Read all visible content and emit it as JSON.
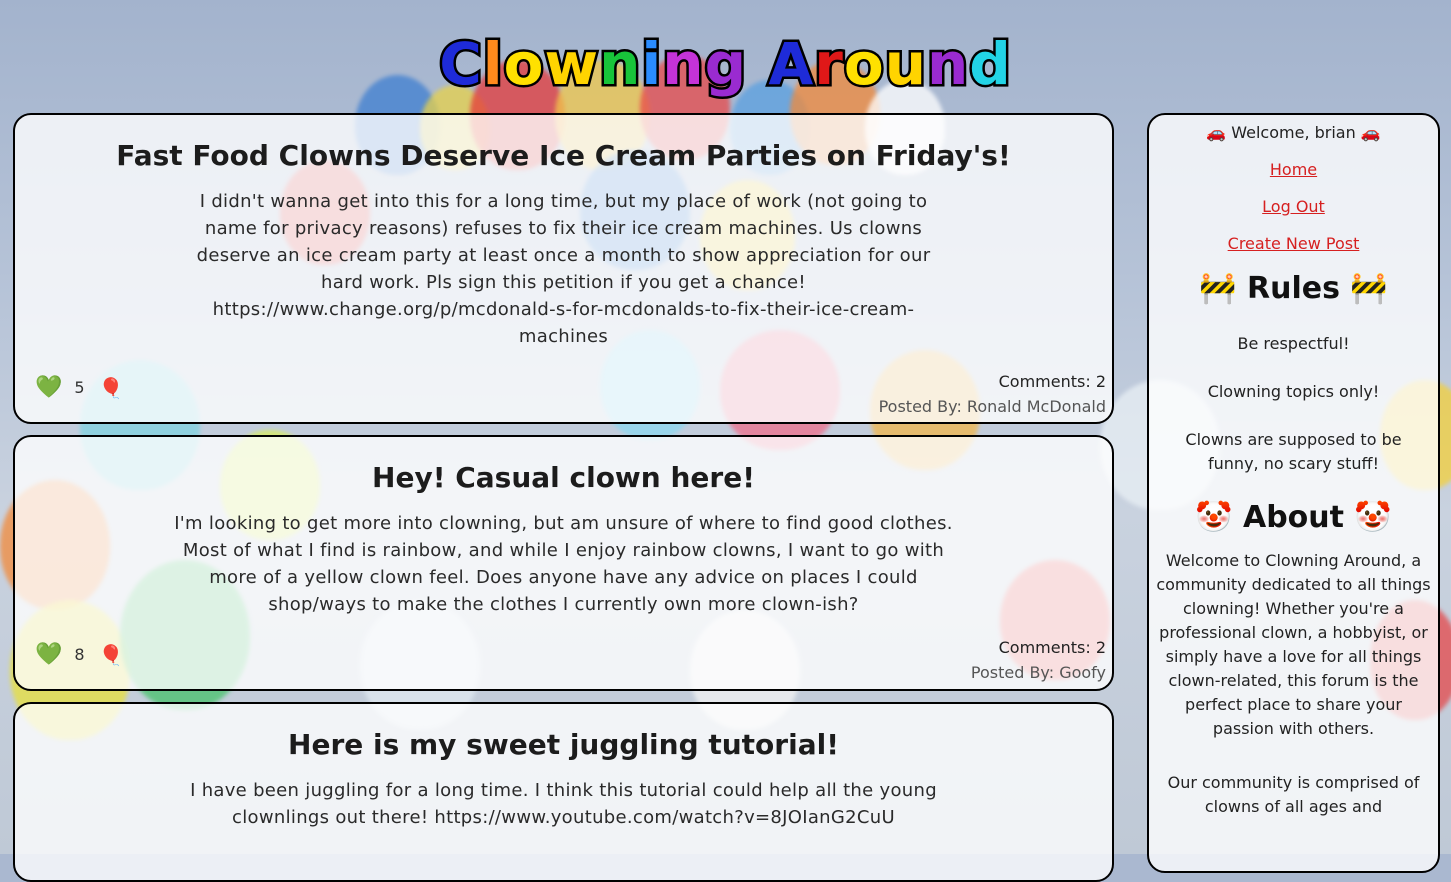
{
  "site": {
    "title_letters": [
      {
        "ch": "C",
        "color": "#1e2bd8"
      },
      {
        "ch": "l",
        "color": "#ff8a1c"
      },
      {
        "ch": "o",
        "color": "#ffe100"
      },
      {
        "ch": "w",
        "color": "#ffd400"
      },
      {
        "ch": "n",
        "color": "#18c43a"
      },
      {
        "ch": "i",
        "color": "#2a8cff"
      },
      {
        "ch": "n",
        "color": "#c433d8"
      },
      {
        "ch": "g",
        "color": "#9a2bd0"
      },
      {
        "ch": " ",
        "color": "#000000"
      },
      {
        "ch": "A",
        "color": "#1e2bd8"
      },
      {
        "ch": "r",
        "color": "#e01818"
      },
      {
        "ch": "o",
        "color": "#ffe100"
      },
      {
        "ch": "u",
        "color": "#ffd400"
      },
      {
        "ch": "n",
        "color": "#9a2bd0"
      },
      {
        "ch": "d",
        "color": "#22d3e6"
      }
    ],
    "title": "Clowning Around"
  },
  "posts": [
    {
      "title": "Fast Food Clowns Deserve Ice Cream Parties on Friday's!",
      "body": "I didn't wanna get into this for a long time, but my place of work (not going to name for privacy reasons) refuses to fix their ice cream machines. Us clowns deserve an ice cream party at least once a month to show appreciation for our hard work. Pls sign this petition if you get a chance! https://www.change.org/p/mcdonald-s-for-mcdonalds-to-fix-their-ice-cream-machines",
      "likes": "5",
      "comments": "Comments: 2",
      "author": "Posted By: Ronald McDonald"
    },
    {
      "title": "Hey! Casual clown here!",
      "body": "I'm looking to get more into clowning, but am unsure of where to find good clothes. Most of what I find is rainbow, and while I enjoy rainbow clowns, I want to go with more of a yellow clown feel. Does anyone have any advice on places I could shop/ways to make the clothes I currently own more clown-ish?",
      "likes": "8",
      "comments": "Comments: 2",
      "author": "Posted By: Goofy"
    },
    {
      "title": "Here is my sweet juggling tutorial!",
      "body": "I have been juggling for a long time. I think this tutorial could help all the young clownlings out there! https://www.youtube.com/watch?v=8JOIanG2CuU"
    }
  ],
  "icons": {
    "like": "green-heart-icon",
    "balloon": "red-balloon-icon",
    "car": "car-icon",
    "construction": "construction-sign-icon",
    "clown": "clown-face-icon"
  },
  "sidebar": {
    "welcome": "🚗 Welcome, brian 🚗",
    "nav": {
      "home": "Home",
      "logout": "Log Out",
      "create": "Create New Post"
    },
    "rules_heading": "🚧 Rules 🚧",
    "rules": [
      "Be respectful!",
      "Clowning topics only!",
      "Clowns are supposed to be funny, no scary stuff!"
    ],
    "about_heading": "🤡 About 🤡",
    "about": [
      "Welcome to Clowning Around, a community dedicated to all things clowning! Whether you're a professional clown, a hobbyist, or simply have a love for all things clown-related, this forum is the perfect place to share your passion with others.",
      "Our community is comprised of clowns of all ages and"
    ]
  }
}
